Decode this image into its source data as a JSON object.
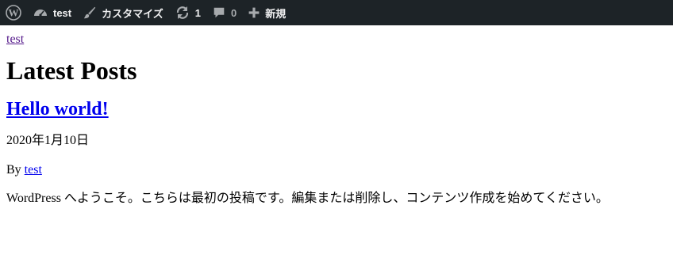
{
  "adminbar": {
    "site_name": "test",
    "customize_label": "カスタマイズ",
    "updates_count": "1",
    "comments_count": "0",
    "new_label": "新規"
  },
  "site": {
    "title_link": "test"
  },
  "page": {
    "heading": "Latest Posts"
  },
  "post": {
    "title": "Hello world!",
    "date": "2020年1月10日",
    "by_prefix": "By",
    "author": "test",
    "excerpt": "WordPress へようこそ。こちらは最初の投稿です。編集または削除し、コンテンツ作成を始めてください。"
  },
  "colors": {
    "adminbar_bg": "#1d2327",
    "adminbar_text": "#f0f0f1",
    "link": "#0000ee",
    "visited_link": "#551a8b"
  }
}
